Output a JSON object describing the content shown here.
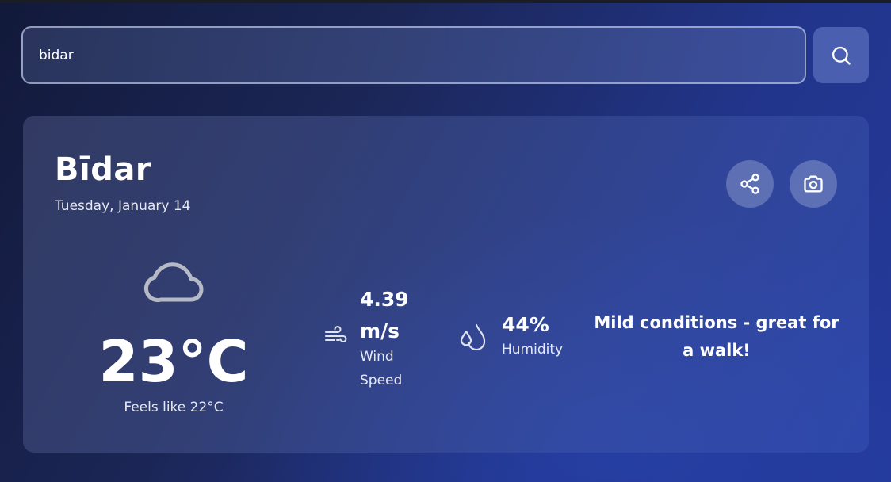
{
  "search": {
    "value": "bidar",
    "icon": "search-icon"
  },
  "weather": {
    "city": "Bīdar",
    "date": "Tuesday, January 14",
    "condition_icon": "cloud-icon",
    "temperature": "23°C",
    "feels_like": "Feels like 22°C",
    "wind": {
      "value": "4.39 m/s",
      "label": "Wind Speed",
      "icon": "wind-icon"
    },
    "humidity": {
      "value": "44%",
      "label": "Humidity",
      "icon": "droplets-icon"
    },
    "advice": "Mild conditions - great for a walk!"
  },
  "actions": {
    "share_icon": "share-icon",
    "camera_icon": "camera-icon"
  },
  "colors": {
    "background_dark": "#12193a",
    "background_accent": "#24399a",
    "text": "#ffffff"
  }
}
